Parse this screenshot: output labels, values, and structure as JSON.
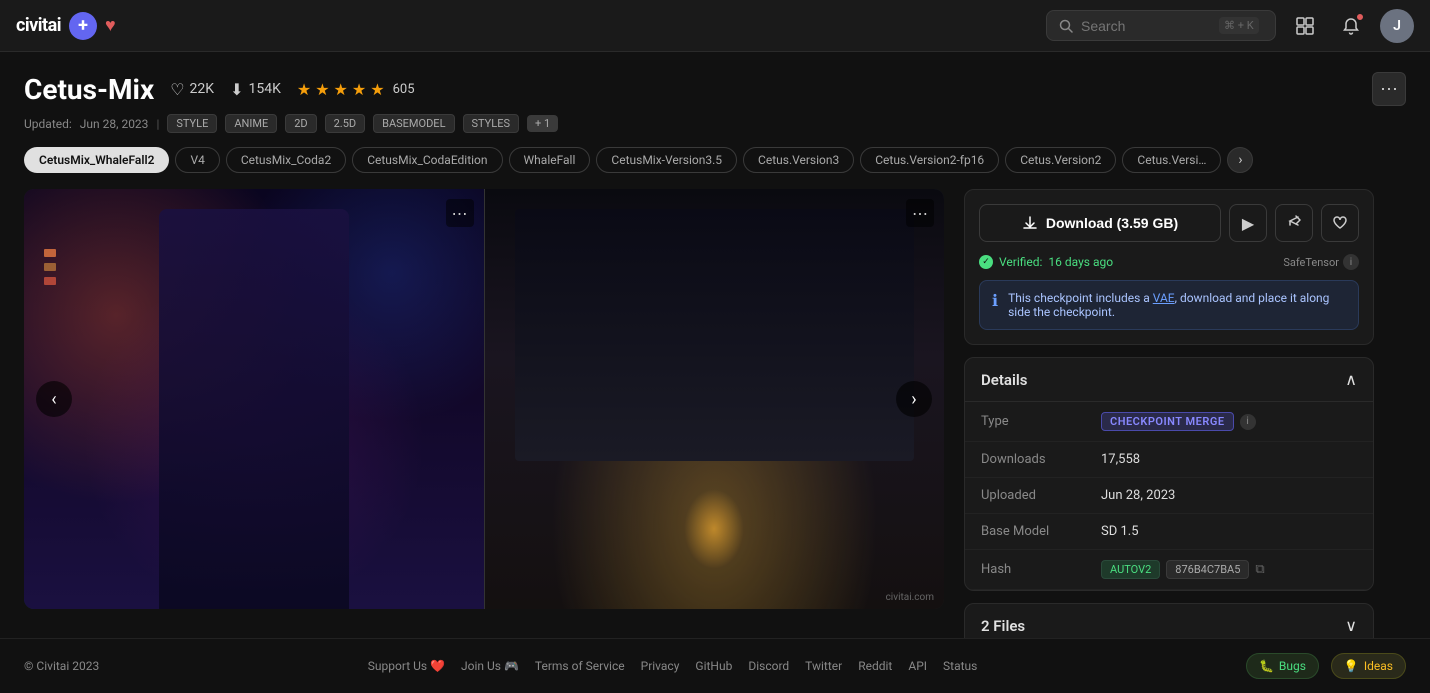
{
  "header": {
    "logo_text": "civitai",
    "plus_icon": "+",
    "heart_icon": "♥",
    "search_placeholder": "Search",
    "search_shortcut": "⌘ + K",
    "notifications_icon": "🔔",
    "gallery_icon": "⊞",
    "avatar_letter": "J"
  },
  "model": {
    "title": "Cetus-Mix",
    "likes": "22K",
    "downloads": "154K",
    "rating_count": "605",
    "updated_label": "Updated:",
    "updated_date": "Jun 28, 2023",
    "tags": [
      "STYLE",
      "ANIME",
      "2D",
      "2.5D",
      "BASEMODEL",
      "STYLES"
    ],
    "plus_tag": "+ 1",
    "more_options": "⋯"
  },
  "version_tabs": [
    {
      "label": "CetusMix_WhaleFall2",
      "active": true
    },
    {
      "label": "V4",
      "active": false
    },
    {
      "label": "CetusMix_Coda2",
      "active": false
    },
    {
      "label": "CetusMix_CodaEdition",
      "active": false
    },
    {
      "label": "WhaleFall",
      "active": false
    },
    {
      "label": "CetusMix-Version3.5",
      "active": false
    },
    {
      "label": "Cetus.Version3",
      "active": false
    },
    {
      "label": "Cetus.Version2-fp16",
      "active": false
    },
    {
      "label": "Cetus.Version2",
      "active": false
    },
    {
      "label": "Cetus.Versi…",
      "active": false
    }
  ],
  "download": {
    "button_label": "Download (3.59 GB)",
    "play_icon": "▶",
    "share_icon": "↗",
    "bookmark_icon": "♡",
    "verified_text": "Verified:",
    "verified_date": "16 days ago",
    "safetensor_label": "SafeTensor",
    "info_icon": "ℹ"
  },
  "vae_notice": {
    "info_icon": "ℹ",
    "text_before": "This checkpoint includes a ",
    "vae_link": "VAE",
    "text_after": ", download and place it along side the checkpoint."
  },
  "details": {
    "section_title": "Details",
    "collapse_icon": "∧",
    "rows": [
      {
        "key": "Type",
        "value": "CHECKPOINT MERGE",
        "type": "badge"
      },
      {
        "key": "Downloads",
        "value": "17,558"
      },
      {
        "key": "Uploaded",
        "value": "Jun 28, 2023"
      },
      {
        "key": "Base Model",
        "value": "SD 1.5"
      },
      {
        "key": "Hash",
        "hash_type": "AUTOV2",
        "hash_value": "876B4C7BA5",
        "copy_icon": "⧉"
      }
    ]
  },
  "files": {
    "section_title": "2 Files",
    "expand_icon": "∨"
  },
  "footer": {
    "copyright": "© Civitai 2023",
    "links": [
      {
        "label": "Support Us ❤️"
      },
      {
        "label": "Join Us 🎮"
      },
      {
        "label": "Terms of Service"
      },
      {
        "label": "Privacy"
      },
      {
        "label": "GitHub"
      },
      {
        "label": "Discord"
      },
      {
        "label": "Twitter"
      },
      {
        "label": "Reddit"
      },
      {
        "label": "API"
      },
      {
        "label": "Status"
      }
    ],
    "bugs_icon": "🐛",
    "bugs_label": "Bugs",
    "ideas_icon": "💡",
    "ideas_label": "Ideas"
  }
}
